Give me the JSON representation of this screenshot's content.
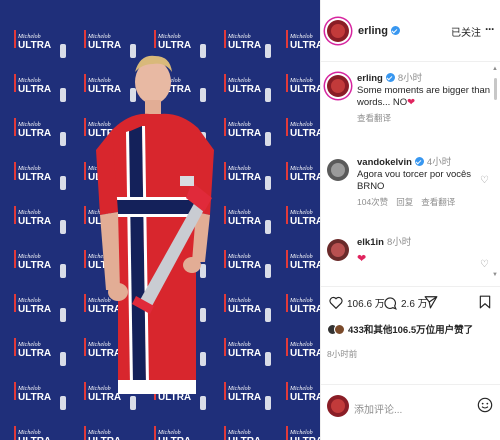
{
  "post": {
    "username": "erling",
    "follow_label": "已关注",
    "more_label": "···",
    "sponsor_logo_line1": "Michelob",
    "sponsor_logo_line2": "ULTRA"
  },
  "comments": [
    {
      "username": "erling",
      "time": "8小时",
      "text": "Some moments are bigger than words... NO",
      "emoji": "❤",
      "translate_label": "查看翻译",
      "verified": true
    },
    {
      "username": "vandokelvin",
      "time": "4小时",
      "text": "Agora vou torcer por vocês BRNO",
      "likes": "104次赞",
      "reply_label": "回复",
      "translate_label": "查看翻译",
      "verified": true
    },
    {
      "username": "elk1in",
      "time": "8小时",
      "text": "❤",
      "verified": false
    }
  ],
  "actions": {
    "like_count": "106.6 万",
    "comment_count": "2.6 万"
  },
  "likes_summary": {
    "text": "433和其他106.5万位用户赞了"
  },
  "post_time": "8小时前",
  "add_comment": {
    "placeholder": "添加评论..."
  },
  "colors": {
    "backdrop": "#1f2f7a",
    "jersey_red": "#d8262d",
    "jersey_navy": "#14215a",
    "heart_red": "#e0245e",
    "verified_blue": "#3897f0"
  },
  "icons": [
    "heart-icon",
    "comment-icon",
    "share-icon",
    "bookmark-icon",
    "emoji-icon",
    "more-icon",
    "verified-icon"
  ]
}
